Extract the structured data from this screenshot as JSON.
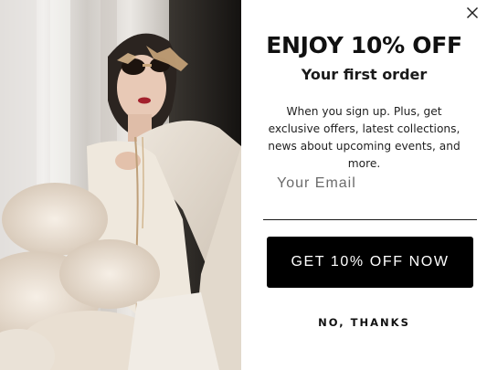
{
  "popup": {
    "headline": "ENJOY 10% OFF",
    "subheadline": "Your first order",
    "description": "When you sign up. Plus, get exclusive offers, latest collections, news about upcoming events, and more.",
    "email": {
      "placeholder": "Your Email",
      "value": ""
    },
    "cta_label": "GET 10% OFF NOW",
    "dismiss_label": "NO, THANKS",
    "close_icon": "close-icon"
  },
  "colors": {
    "button_bg": "#000000",
    "button_text": "#ffffff",
    "panel_bg": "#ffffff",
    "text": "#111111"
  }
}
